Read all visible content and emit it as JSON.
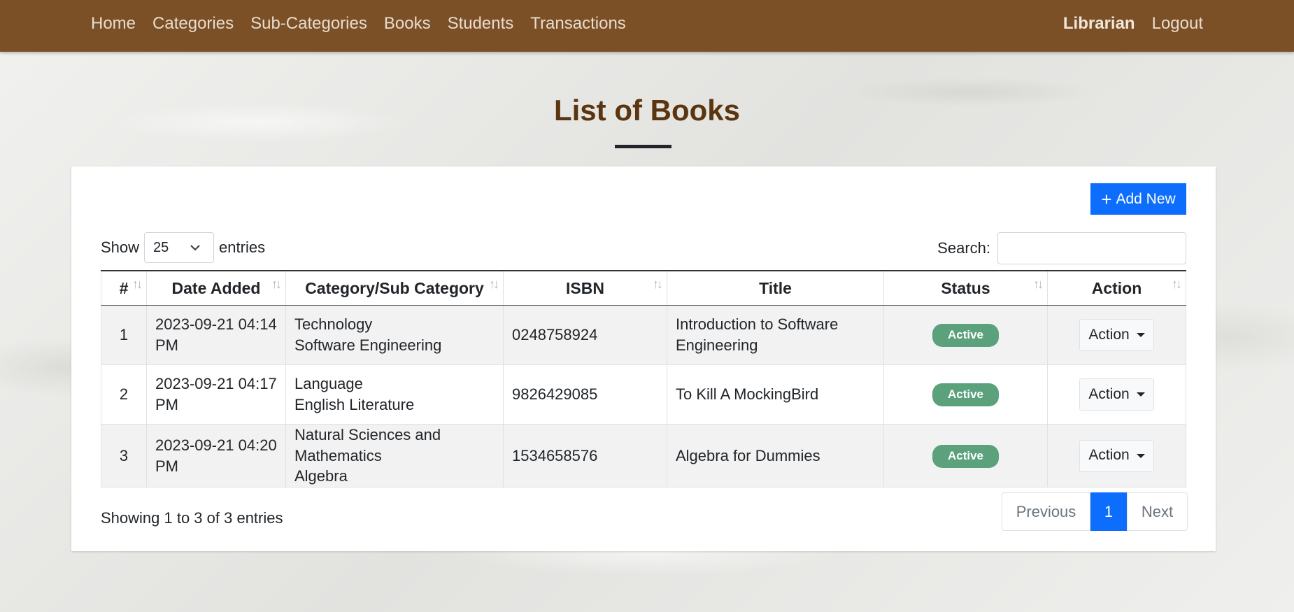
{
  "nav": {
    "left": [
      "Home",
      "Categories",
      "Sub-Categories",
      "Books",
      "Students",
      "Transactions"
    ],
    "librarian": "Librarian",
    "logout": "Logout"
  },
  "page": {
    "title": "List of Books"
  },
  "toolbar": {
    "add_label": "Add New"
  },
  "length": {
    "show": "Show",
    "value": "25",
    "entries": "entries"
  },
  "search": {
    "label": "Search:",
    "value": ""
  },
  "table": {
    "headers": [
      "#",
      "Date Added",
      "Category/Sub Category",
      "ISBN",
      "Title",
      "Status",
      "Action"
    ],
    "rows": [
      {
        "num": "1",
        "date": "2023-09-21 04:14 PM",
        "category": "Technology",
        "subcategory": "Software Engineering",
        "isbn": "0248758924",
        "title": "Introduction to Software Engineering",
        "status": "Active",
        "action": "Action"
      },
      {
        "num": "2",
        "date": "2023-09-21 04:17 PM",
        "category": "Language",
        "subcategory": "English Literature",
        "isbn": "9826429085",
        "title": "To Kill A MockingBird",
        "status": "Active",
        "action": "Action"
      },
      {
        "num": "3",
        "date": "2023-09-21 04:20 PM",
        "category": "Natural Sciences and Mathematics",
        "subcategory": "Algebra",
        "isbn": "1534658576",
        "title": "Algebra for Dummies",
        "status": "Active",
        "action": "Action"
      }
    ]
  },
  "footer": {
    "info": "Showing 1 to 3 of 3 entries",
    "prev": "Previous",
    "page": "1",
    "next": "Next"
  },
  "colors": {
    "navbar": "#7b5027",
    "title": "#5b3510",
    "primary": "#0d6efd",
    "badge": "#5aa17c"
  }
}
